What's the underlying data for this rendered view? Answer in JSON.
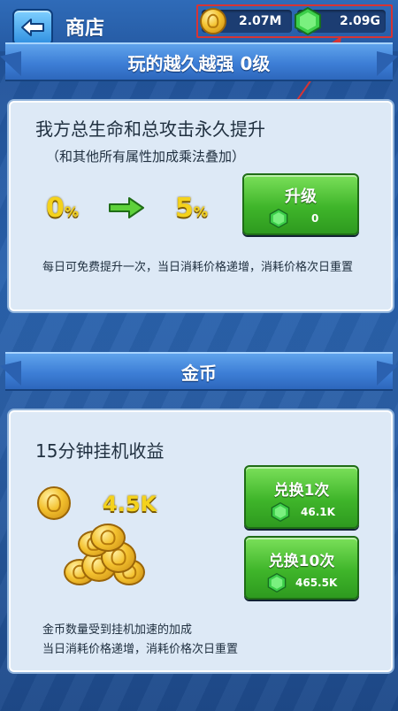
{
  "header": {
    "title": "商店",
    "gold_value": "2.07M",
    "gem_value": "2.09G"
  },
  "upgrade_section": {
    "banner": "玩的越久越强 0级",
    "heading": "我方总生命和总攻击永久提升",
    "subheading": "（和其他所有属性加成乘法叠加）",
    "current_pct": "0",
    "next_pct": "5",
    "pct_unit": "%",
    "upgrade_label": "升级",
    "upgrade_cost": "0",
    "note": "每日可免费提升一次，当日消耗价格递增，消耗价格次日重置"
  },
  "gold_section": {
    "banner": "金币",
    "heading": "15分钟挂机收益",
    "amount": "4.5K",
    "exchange1_label": "兑换1次",
    "exchange1_cost": "46.1K",
    "exchange10_label": "兑换10次",
    "exchange10_cost": "465.5K",
    "note_line1": "金币数量受到挂机加速的加成",
    "note_line2": "当日消耗价格递增，消耗价格次日重置"
  },
  "colors": {
    "highlight": "#d73434",
    "gold_text": "#f4d21c",
    "button_green": "#3fb52a"
  }
}
